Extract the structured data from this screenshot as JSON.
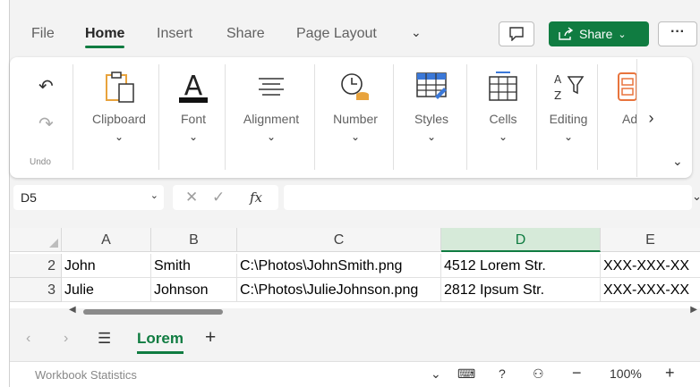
{
  "menu": {
    "tabs": [
      "File",
      "Home",
      "Insert",
      "Share",
      "Page Layout"
    ],
    "active": "Home",
    "share_label": "Share",
    "more_label": "···"
  },
  "ribbon": {
    "undo_label": "Undo",
    "groups": [
      "Clipboard",
      "Font",
      "Alignment",
      "Number",
      "Styles",
      "Cells",
      "Editing",
      "Add"
    ]
  },
  "formula_bar": {
    "name_box": "D5",
    "fx": "fx",
    "value": ""
  },
  "grid": {
    "corner": "",
    "columns": [
      {
        "label": "A",
        "selected": false
      },
      {
        "label": "B",
        "selected": false
      },
      {
        "label": "C",
        "selected": false
      },
      {
        "label": "D",
        "selected": true
      },
      {
        "label": "E",
        "selected": false
      }
    ],
    "rows": [
      {
        "num": "2",
        "cells": [
          "John",
          "Smith",
          "C:\\Photos\\JohnSmith.png",
          "4512 Lorem Str.",
          "XXX-XXX-XX"
        ]
      },
      {
        "num": "3",
        "cells": [
          "Julie",
          "Johnson",
          "C:\\Photos\\JulieJohnson.png",
          "2812 Ipsum Str.",
          "XXX-XXX-XX"
        ]
      }
    ]
  },
  "sheets": {
    "active": "Lorem"
  },
  "status": {
    "stats_label": "Workbook Statistics",
    "zoom": "100%"
  },
  "colors": {
    "accent": "#107c41",
    "selected_column": "#d6ead9"
  }
}
